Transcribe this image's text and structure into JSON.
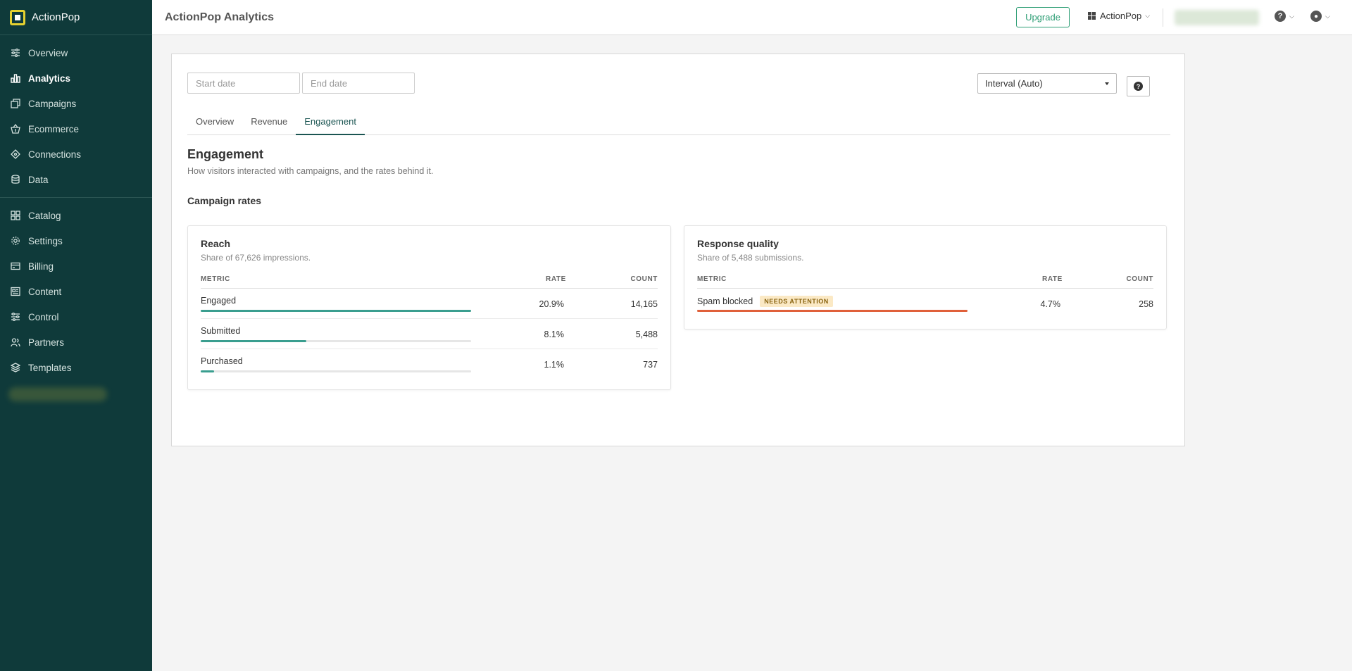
{
  "brand": {
    "name": "ActionPop"
  },
  "sidebar": {
    "group1": [
      {
        "label": "Overview",
        "icon": "sliders-icon",
        "active": false
      },
      {
        "label": "Analytics",
        "icon": "bar-chart-icon",
        "active": true
      },
      {
        "label": "Campaigns",
        "icon": "layers-window-icon",
        "active": false
      },
      {
        "label": "Ecommerce",
        "icon": "basket-icon",
        "active": false
      },
      {
        "label": "Connections",
        "icon": "diamond-nodes-icon",
        "active": false
      },
      {
        "label": "Data",
        "icon": "database-icon",
        "active": false
      }
    ],
    "group2": [
      {
        "label": "Catalog",
        "icon": "grid-icon",
        "active": false
      },
      {
        "label": "Settings",
        "icon": "gear-icon",
        "active": false
      },
      {
        "label": "Billing",
        "icon": "credit-card-icon",
        "active": false
      },
      {
        "label": "Content",
        "icon": "content-icon",
        "active": false
      },
      {
        "label": "Control",
        "icon": "control-sliders-icon",
        "active": false
      },
      {
        "label": "Partners",
        "icon": "people-icon",
        "active": false
      },
      {
        "label": "Templates",
        "icon": "stack-icon",
        "active": false
      }
    ]
  },
  "header": {
    "title": "ActionPop Analytics",
    "upgrade_label": "Upgrade",
    "workspace_label": "ActionPop"
  },
  "filters": {
    "start_placeholder": "Start date",
    "end_placeholder": "End date",
    "interval_label": "Interval (Auto)"
  },
  "tabs": [
    {
      "label": "Overview",
      "active": false
    },
    {
      "label": "Revenue",
      "active": false
    },
    {
      "label": "Engagement",
      "active": true
    }
  ],
  "section": {
    "title": "Engagement",
    "description": "How visitors interacted with campaigns, and the rates behind it.",
    "subtitle": "Campaign rates"
  },
  "columns": {
    "metric": "METRIC",
    "rate": "RATE",
    "count": "COUNT"
  },
  "reach": {
    "title": "Reach",
    "subtitle": "Share of 67,626 impressions.",
    "rows": [
      {
        "metric": "Engaged",
        "rate": "20.9%",
        "count": "14,165",
        "fill": 1.0
      },
      {
        "metric": "Submitted",
        "rate": "8.1%",
        "count": "5,488",
        "fill": 0.39
      },
      {
        "metric": "Purchased",
        "rate": "1.1%",
        "count": "737",
        "fill": 0.05
      }
    ]
  },
  "quality": {
    "title": "Response quality",
    "subtitle": "Share of 5,488 submissions.",
    "rows": [
      {
        "metric": "Spam blocked",
        "badge": "NEEDS ATTENTION",
        "rate": "4.7%",
        "count": "258",
        "fill": 1.0
      }
    ]
  },
  "colors": {
    "sidebar_bg": "#0f3a3a",
    "accent": "#2e9e75",
    "reach_bar": "#3a9e8f",
    "alert_bar": "#e0603a",
    "badge_bg": "#fbe9c5"
  }
}
